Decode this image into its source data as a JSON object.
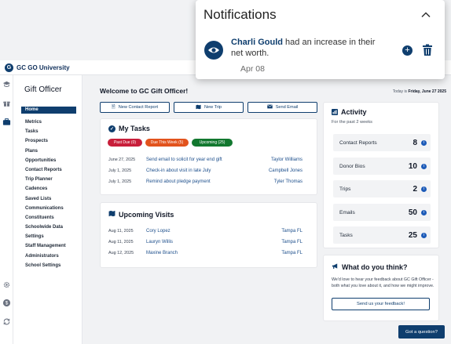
{
  "brand": {
    "logo_letter": "G",
    "name": "GC GO University"
  },
  "sidebar": {
    "title": "Gift Officer",
    "items": [
      {
        "label": "Home",
        "active": true
      },
      {
        "label": "Metrics"
      },
      {
        "label": "Tasks"
      },
      {
        "label": "Prospects"
      },
      {
        "label": "Plans"
      },
      {
        "label": "Opportunities"
      },
      {
        "label": "Contact Reports"
      },
      {
        "label": "Trip Planner"
      },
      {
        "label": "Cadences"
      },
      {
        "label": "Saved Lists"
      },
      {
        "label": "Communications"
      },
      {
        "label": "Constituents"
      },
      {
        "label": "Schoolwide Data"
      },
      {
        "label": "Settings"
      },
      {
        "label": "Staff Management"
      },
      {
        "label": "Administrators"
      },
      {
        "label": "School Settings"
      }
    ]
  },
  "main": {
    "welcome": "Welcome to GC Gift Officer!",
    "today_prefix": "Today is",
    "today_date": "Friday, June 27 2025",
    "buttons": {
      "new_contact_report": "New Contact Report",
      "new_trip": "New Trip",
      "send_email": "Send Email"
    },
    "tasks": {
      "title": "My Tasks",
      "filters": [
        {
          "label": "Past Due (0)",
          "color": "#c81e3a"
        },
        {
          "label": "Due This Week (5)",
          "color": "#e2531d"
        },
        {
          "label": "Upcoming (25)",
          "color": "#12782f"
        }
      ],
      "rows": [
        {
          "date": "June 27, 2025",
          "task": "Send email to solicit for year end gift",
          "who": "Taylor Williams"
        },
        {
          "date": "July 1, 2025",
          "task": "Check-in about visit in late July",
          "who": "Campbell Jones"
        },
        {
          "date": "July 1, 2025",
          "task": "Remind about pledge payment",
          "who": "Tyler Thomas"
        }
      ]
    },
    "visits": {
      "title": "Upcoming Visits",
      "rows": [
        {
          "date": "Aug 11, 2025",
          "name": "Cory Lopez",
          "place": "Tampa FL"
        },
        {
          "date": "Aug 11, 2025",
          "name": "Lauryn Willis",
          "place": "Tampa FL"
        },
        {
          "date": "Aug 12, 2025",
          "name": "Maxine Branch",
          "place": "Tampa FL"
        }
      ]
    },
    "activity": {
      "title": "Activity",
      "subtitle": "For the past 2 weeks",
      "rows": [
        {
          "label": "Contact Reports",
          "value": "8"
        },
        {
          "label": "Donor Bios",
          "value": "10"
        },
        {
          "label": "Trips",
          "value": "2"
        },
        {
          "label": "Emails",
          "value": "50"
        },
        {
          "label": "Tasks",
          "value": "25"
        }
      ]
    },
    "feedback": {
      "title": "What do you think?",
      "body": "We'd love to hear your feedback about GC Gift Officer - both what you love about it, and how we might improve.",
      "button": "Send us your feedback!"
    },
    "question_button": "Got a question?"
  },
  "notification": {
    "header": "Notifications",
    "name": "Charli Gould",
    "message": " had an increase in their net worth.",
    "date": "Apr 08"
  },
  "colors": {
    "primary": "#0f3e6e",
    "link": "#1d4f8c",
    "info": "#1d5bb8"
  }
}
